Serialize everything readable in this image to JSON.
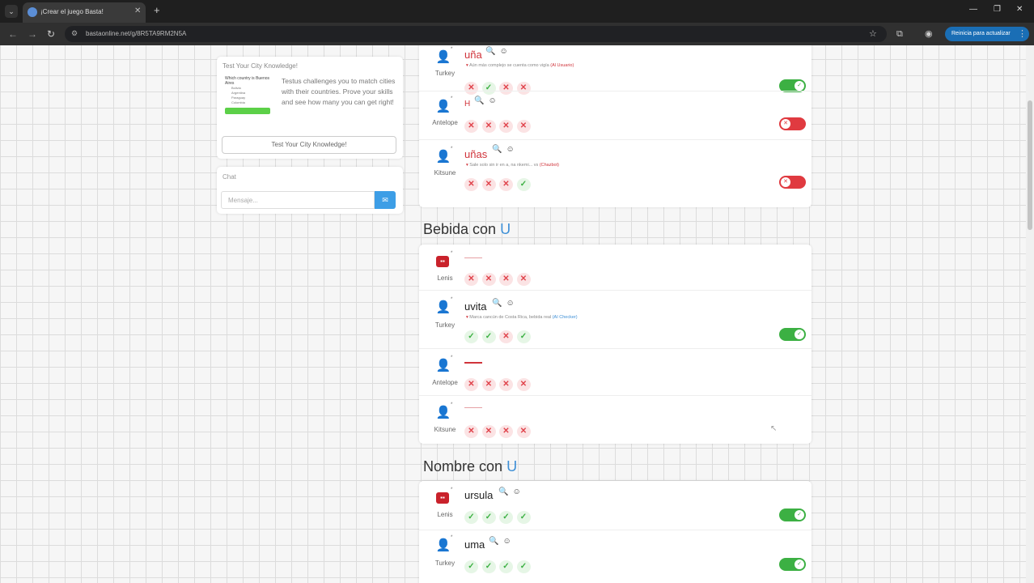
{
  "browser": {
    "tab_title": "¡Crear el juego Basta!",
    "url": "bastaonline.net/g/8R5TA9RM2N5A",
    "update_label": "Reinicia para actualizar"
  },
  "ad": {
    "title": "Test Your City Knowledge!",
    "thumb_heading": "Which country is Buenos Aires",
    "thumb_options": [
      "Bolivia",
      "Argentina",
      "Paraguay",
      "Colombia"
    ],
    "text": "Testus challenges you to match cities with their countries. Prove your skills and see how many you can get right!",
    "button": "Test Your City Knowledge!"
  },
  "chat": {
    "title": "Chat",
    "placeholder": "Mensaje..."
  },
  "top_rows": [
    {
      "player": "Turkey",
      "word": "uña",
      "note": "Aún más complejo se cuenta como vigía",
      "note_link": "(Al Usuario)",
      "marks": [
        "x",
        "ok",
        "x",
        "x"
      ],
      "toggle": "on"
    },
    {
      "player": "Antelope",
      "word": "H",
      "marks": [
        "x",
        "x",
        "x",
        "x"
      ],
      "toggle": "off"
    },
    {
      "player": "Kitsune",
      "word": "uñas",
      "note": "Sale solo sin ir en a, na nkemi... vs",
      "note_link": "(Chazbot)",
      "marks": [
        "x",
        "x",
        "x",
        "ok"
      ],
      "toggle": "off"
    }
  ],
  "bebida": {
    "title": "Bebida con",
    "letter": "U",
    "rows": [
      {
        "player": "Lenis",
        "robot": true,
        "marks": [
          "x",
          "x",
          "x",
          "x"
        ]
      },
      {
        "player": "Turkey",
        "word": "uvita",
        "note": "Marca cancún de Costa Rica, bebida real",
        "note_link": "(AI Checker)",
        "marks": [
          "ok",
          "ok",
          "x",
          "ok"
        ],
        "toggle": "on"
      },
      {
        "player": "Antelope",
        "marks": [
          "x",
          "x",
          "x",
          "x"
        ]
      },
      {
        "player": "Kitsune",
        "marks": [
          "x",
          "x",
          "x",
          "x"
        ]
      }
    ]
  },
  "nombre": {
    "title": "Nombre con",
    "letter": "U",
    "rows": [
      {
        "player": "Lenis",
        "robot": true,
        "word": "ursula",
        "marks": [
          "ok",
          "ok",
          "ok",
          "ok"
        ],
        "toggle": "on"
      },
      {
        "player": "Turkey",
        "word": "uma",
        "marks": [
          "ok",
          "ok",
          "ok",
          "ok"
        ],
        "toggle": "on"
      }
    ]
  },
  "icons": {
    "search": "magnifier-icon",
    "emoji": "smiley-icon",
    "user": "user-icon",
    "check": "✓",
    "cross": "✕"
  }
}
